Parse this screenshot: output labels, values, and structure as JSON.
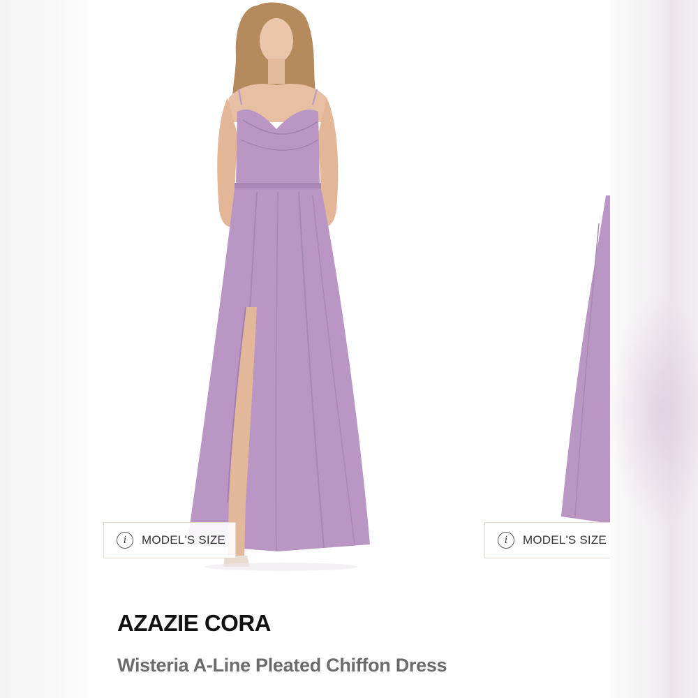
{
  "product": {
    "brand": "AZAZIE CORA",
    "name": "Wisteria A-Line Pleated Chiffon Dress"
  },
  "carousel": {
    "badges": [
      {
        "icon": "info-icon",
        "label": "MODEL'S SIZE"
      },
      {
        "icon": "info-icon",
        "label": "MODEL'S SIZE"
      }
    ]
  },
  "colors": {
    "dress": "#b996c4",
    "dress_shadow": "#a27fae",
    "skin": "#e7bfa3",
    "hair": "#b58a5c",
    "badge_border": "#e2d8cc"
  }
}
